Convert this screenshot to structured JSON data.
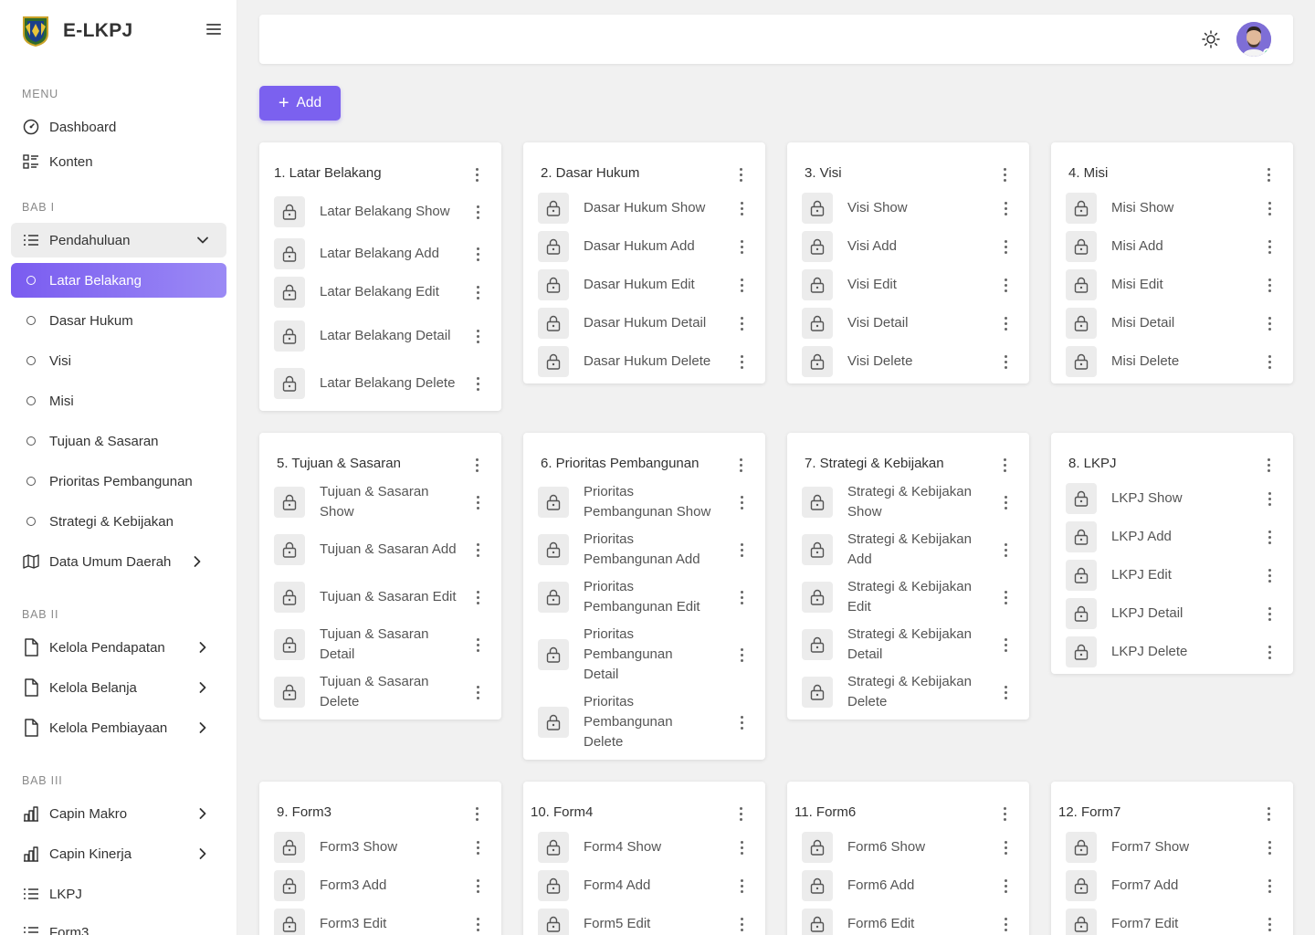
{
  "app": {
    "name": "E-LKPJ"
  },
  "sidebar": {
    "menu_label": "MENU",
    "bab1_label": "BAB I",
    "bab2_label": "BAB II",
    "bab3_label": "BAB III",
    "dashboard": "Dashboard",
    "konten": "Konten",
    "pendahuluan": "Pendahuluan",
    "latar_belakang": "Latar Belakang",
    "dasar_hukum": "Dasar Hukum",
    "visi": "Visi",
    "misi": "Misi",
    "tujuan": "Tujuan & Sasaran",
    "prioritas": "Prioritas Pembangunan",
    "strategi": "Strategi & Kebijakan",
    "data_umum": "Data Umum Daerah",
    "kelola_pendapatan": "Kelola Pendapatan",
    "kelola_belanja": "Kelola Belanja",
    "kelola_pembiayaan": "Kelola Pembiayaan",
    "capin_makro": "Capin Makro",
    "capin_kinerja": "Capin Kinerja",
    "lkpj": "LKPJ",
    "form3": "Form3"
  },
  "toolbar": {
    "add_label": "Add"
  },
  "cards": [
    {
      "title": "1. Latar Belakang",
      "items": [
        "Latar Belakang Show",
        "Latar Belakang Add",
        "Latar Belakang Edit",
        "Latar Belakang Detail",
        "Latar Belakang Delete"
      ]
    },
    {
      "title": "2. Dasar Hukum",
      "items": [
        "Dasar Hukum Show",
        "Dasar Hukum Add",
        "Dasar Hukum Edit",
        "Dasar Hukum Detail",
        "Dasar Hukum Delete"
      ]
    },
    {
      "title": "3. Visi",
      "items": [
        "Visi Show",
        "Visi Add",
        "Visi Edit",
        "Visi Detail",
        "Visi Delete"
      ]
    },
    {
      "title": "4. Misi",
      "items": [
        "Misi Show",
        "Misi Add",
        "Misi Edit",
        "Misi Detail",
        "Misi Delete"
      ]
    },
    {
      "title": "5. Tujuan & Sasaran",
      "items": [
        "Tujuan & Sasaran Show",
        "Tujuan & Sasaran Add",
        "Tujuan & Sasaran Edit",
        "Tujuan & Sasaran Detail",
        "Tujuan & Sasaran Delete"
      ]
    },
    {
      "title": "6. Prioritas Pembangunan",
      "items": [
        "Prioritas Pembangunan Show",
        "Prioritas Pembangunan Add",
        "Prioritas Pembangunan Edit",
        "Prioritas Pembangunan Detail",
        "Prioritas Pembangunan Delete"
      ]
    },
    {
      "title": "7. Strategi & Kebijakan",
      "items": [
        "Strategi & Kebijakan Show",
        "Strategi & Kebijakan Add",
        "Strategi & Kebijakan Edit",
        "Strategi & Kebijakan Detail",
        "Strategi & Kebijakan Delete"
      ]
    },
    {
      "title": "8. LKPJ",
      "items": [
        "LKPJ Show",
        "LKPJ Add",
        "LKPJ Edit",
        "LKPJ Detail",
        "LKPJ Delete"
      ]
    },
    {
      "title": "9. Form3",
      "items": [
        "Form3 Show",
        "Form3 Add",
        "Form3 Edit"
      ]
    },
    {
      "title": "10. Form4",
      "items": [
        "Form4 Show",
        "Form4 Add",
        "Form5 Edit"
      ]
    },
    {
      "title": "11. Form6",
      "items": [
        "Form6 Show",
        "Form6 Add",
        "Form6 Edit"
      ]
    },
    {
      "title": "12. Form7",
      "items": [
        "Form7 Show",
        "Form7 Add",
        "Form7 Edit"
      ]
    }
  ]
}
